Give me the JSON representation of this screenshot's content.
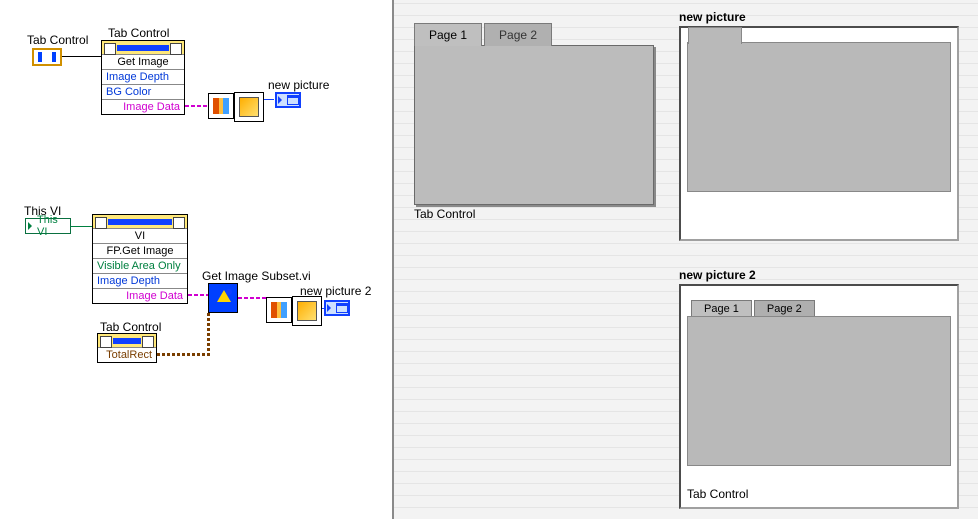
{
  "bd": {
    "tab_control_label_top": "Tab Control",
    "tab_control_node_title": "Tab Control",
    "get_image": "Get Image",
    "image_depth": "Image Depth",
    "bg_color": "BG Color",
    "image_data": "Image Data",
    "new_picture_label": "new picture",
    "this_vi_label": "This VI",
    "this_vi_box": "This VI",
    "vi_node_title": "VI",
    "fp_get_image": "FP.Get Image",
    "visible_area_only": "Visible Area Only",
    "image_depth2": "Image Depth",
    "image_data2": "Image Data",
    "get_image_subset": "Get Image Subset.vi",
    "new_picture2_label": "new picture 2",
    "tab_control_label_bottom": "Tab Control",
    "total_rect": "TotalRect"
  },
  "fp": {
    "tab": {
      "page1": "Page 1",
      "page2": "Page 2",
      "caption": "Tab Control"
    },
    "pic1": {
      "caption": "new picture"
    },
    "pic2": {
      "caption": "new picture 2",
      "page1": "Page 1",
      "page2": "Page 2",
      "subcaption": "Tab Control"
    }
  }
}
